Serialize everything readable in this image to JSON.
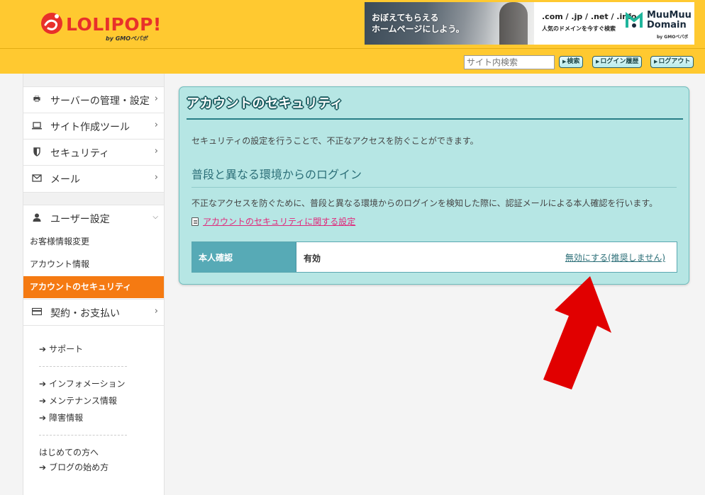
{
  "header": {
    "logo_text": "LOLIPOP!",
    "logo_sub": "by GMOペパボ",
    "banner": {
      "copy_line1": "おぼえてもらえる",
      "copy_line2": "ホームページにしよう。",
      "domains": ".com / .jp / .net / .info",
      "tagline": "人気のドメインを今すぐ検索",
      "brand_line1": "MuuMuu",
      "brand_line2": "Domain",
      "brand_sub": "by GMOペパボ"
    },
    "search_placeholder": "サイト内検索",
    "buttons": {
      "search": "検索",
      "login_history": "ログイン履歴",
      "logout": "ログアウト"
    },
    "colors": {
      "background": "#ffc930",
      "logo_red": "#e8302a"
    }
  },
  "sidebar": {
    "nav": [
      {
        "label": "サーバーの管理・設定",
        "icon": "server-icon"
      },
      {
        "label": "サイト作成ツール",
        "icon": "laptop-icon"
      },
      {
        "label": "セキュリティ",
        "icon": "shield-icon"
      },
      {
        "label": "メール",
        "icon": "envelope-icon"
      }
    ],
    "user_settings": {
      "label": "ユーザー設定",
      "icon": "user-icon",
      "sub_items": [
        "お客様情報変更",
        "アカウント情報",
        "アカウントのセキュリティ"
      ],
      "active_index": 2
    },
    "contract": {
      "label": "契約・お支払い",
      "icon": "credit-card-icon"
    },
    "links_1": [
      "サポート"
    ],
    "links_2": [
      "インフォメーション",
      "メンテナンス情報",
      "障害情報"
    ],
    "first_time": "はじめての方へ",
    "links_3": [
      "ブログの始め方"
    ],
    "active_color": "#f57a12"
  },
  "main": {
    "title": "アカウントのセキュリティ",
    "intro": "セキュリティの設定を行うことで、不正なアクセスを防ぐことができます。",
    "section_heading": "普段と異なる環境からのログイン",
    "description": "不正なアクセスを防ぐために、普段と異なる環境からのログインを検知した際に、認証メールによる本人確認を行います。",
    "settings_link": "アカウントのセキュリティに関する設定",
    "table": {
      "header": "本人確認",
      "value": "有効",
      "action_link": "無効にする(推奨しません)"
    },
    "colors": {
      "panel": "#b6e6e4",
      "header_cell": "#57aab6",
      "link": "#e0287a"
    }
  },
  "annotation": {
    "icon": "red-arrow-icon",
    "color": "#e10000"
  }
}
